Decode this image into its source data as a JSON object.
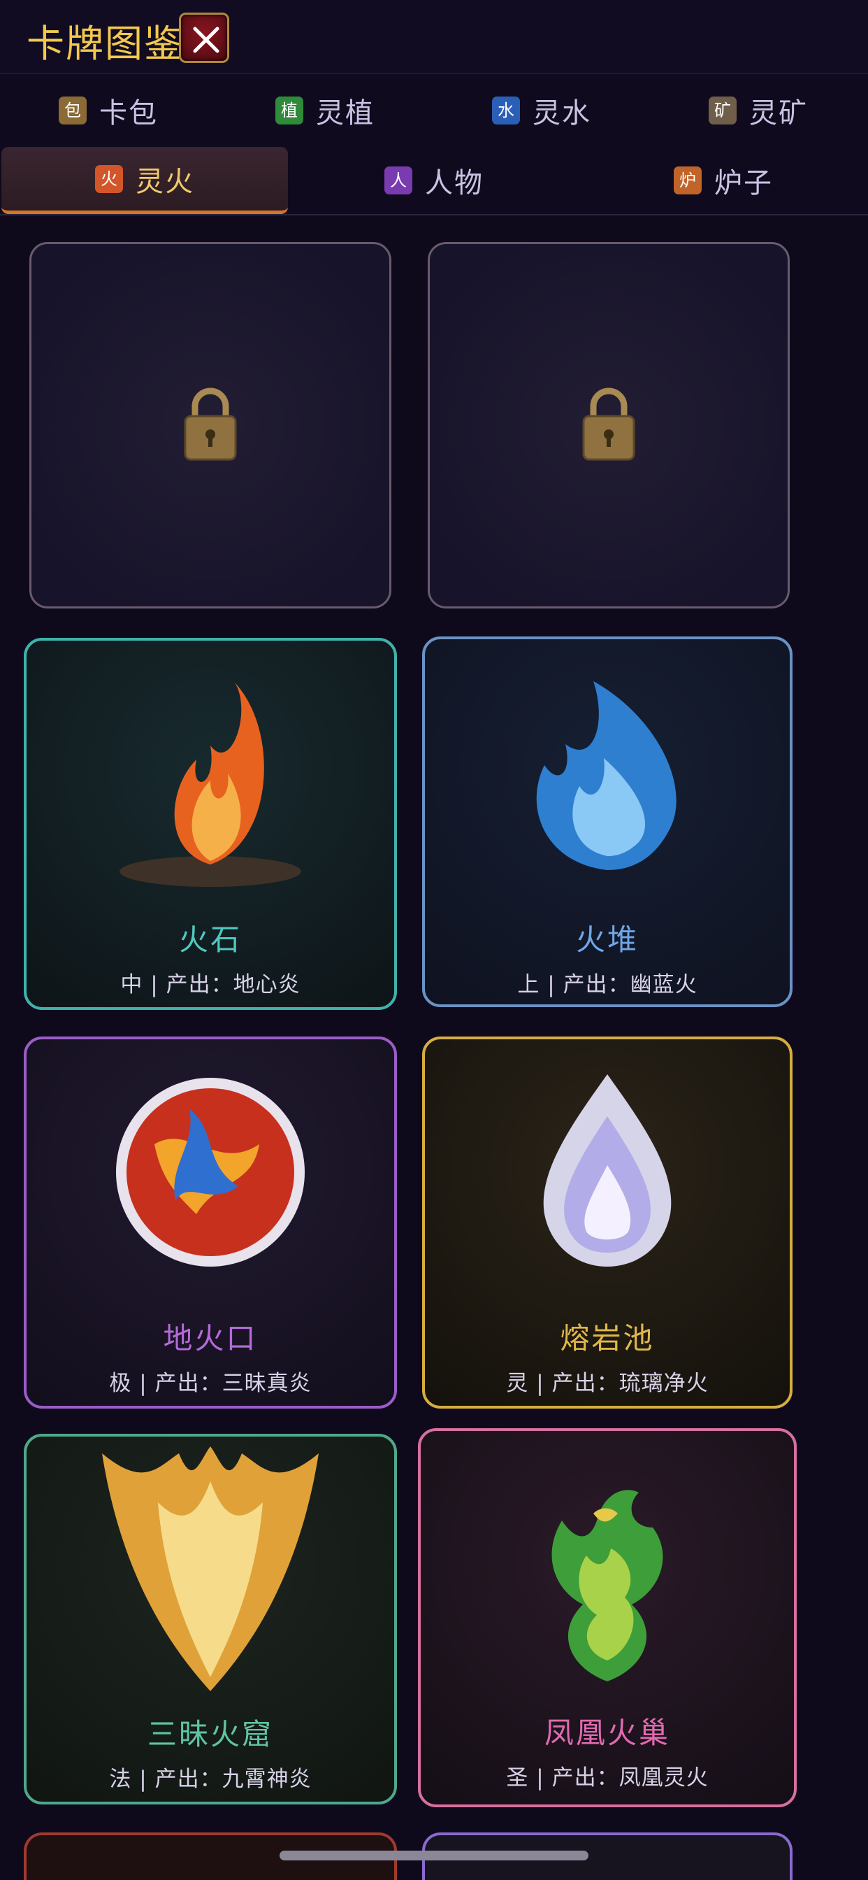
{
  "header": {
    "title": "卡牌图鉴",
    "close_icon": "close-icon"
  },
  "tabs": [
    {
      "badge": "包",
      "label": "卡包",
      "color": "#8a6a35"
    },
    {
      "badge": "植",
      "label": "灵植",
      "color": "#2f8a3a"
    },
    {
      "badge": "水",
      "label": "灵水",
      "color": "#2a5fb8"
    },
    {
      "badge": "矿",
      "label": "灵矿",
      "color": "#6f5e4a"
    },
    {
      "badge": "火",
      "label": "灵火",
      "color": "#d2562a",
      "active": true
    },
    {
      "badge": "人",
      "label": "人物",
      "color": "#7a3ab0"
    },
    {
      "badge": "炉",
      "label": "炉子",
      "color": "#c0642a"
    }
  ],
  "cards": [
    {
      "locked": true,
      "icon": "lock-icon"
    },
    {
      "locked": true,
      "icon": "lock-icon"
    },
    {
      "name": "火石",
      "desc": "中 | 产出：地心炎",
      "accent": "#4fc9c0",
      "icon": "campfire-icon"
    },
    {
      "name": "火堆",
      "desc": "上 | 产出：幽蓝火",
      "accent": "#6fa7e8",
      "icon": "blue-flame-icon"
    },
    {
      "name": "地火口",
      "desc": "极 | 产出：三昧真炎",
      "accent": "#b46ad8",
      "icon": "fire-orb-icon"
    },
    {
      "name": "熔岩池",
      "desc": "灵 | 产出：琉璃净火",
      "accent": "#e0b84a",
      "icon": "crystal-flame-icon"
    },
    {
      "name": "三昧火窟",
      "desc": "法 | 产出：九霄神炎",
      "accent": "#5fc4a4",
      "icon": "golden-flame-icon"
    },
    {
      "name": "凤凰火巢",
      "desc": "圣 | 产出：凤凰灵火",
      "accent": "#e06ab0",
      "icon": "phoenix-icon"
    }
  ]
}
